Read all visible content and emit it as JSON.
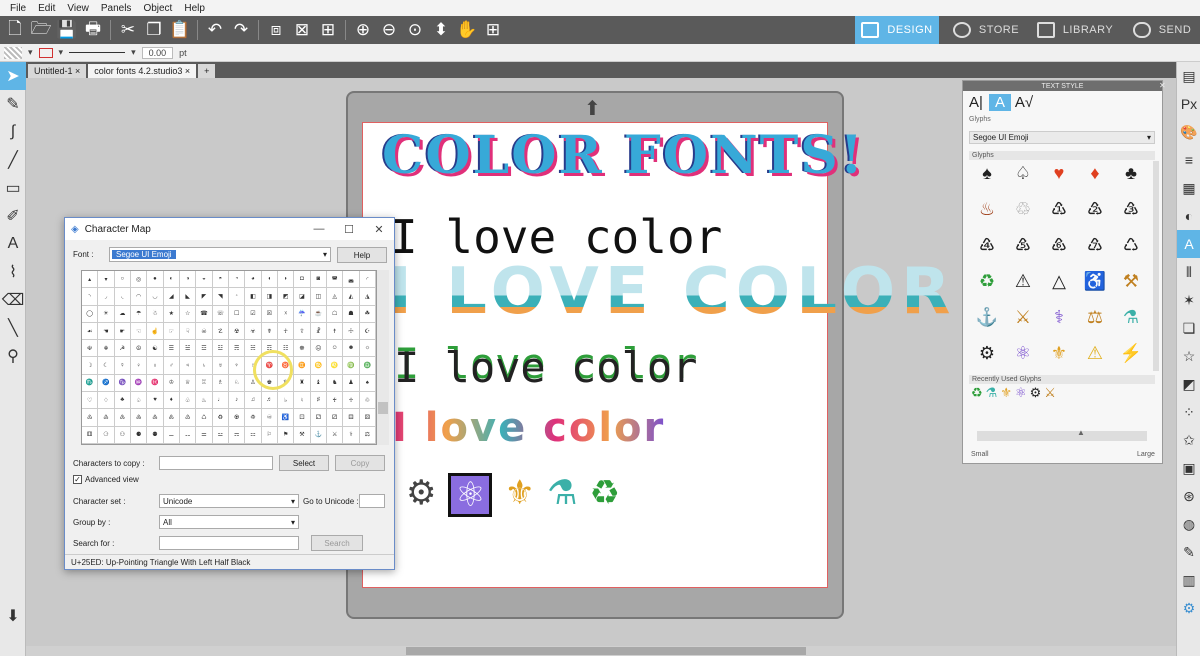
{
  "menu": [
    "File",
    "Edit",
    "View",
    "Panels",
    "Object",
    "Help"
  ],
  "nav_tabs": {
    "design": {
      "label": "DESIGN",
      "color": "#5fb5e6"
    },
    "store": {
      "label": "STORE"
    },
    "library": {
      "label": "LIBRARY"
    },
    "send": {
      "label": "SEND"
    }
  },
  "options": {
    "line_width": "0.00",
    "unit": "pt"
  },
  "doc_tabs": [
    "Untitled-1",
    "color fonts 4.2.studio3",
    "+"
  ],
  "canvas": {
    "line1": "COLOR FONTS!",
    "line2": "I love color",
    "line3": "I LOVE COLOR",
    "line4": "I love color",
    "line5": "I love color",
    "colors": {
      "cyan": "#37a9d8",
      "pink": "#e0307a",
      "orange": "#f0a04b",
      "teal": "#3bb0b8",
      "navy": "#283b8a",
      "green": "#2e9e3a"
    }
  },
  "charmap": {
    "title": "Character Map",
    "font_label": "Font :",
    "font_value": "Segoe UI Emoji",
    "help": "Help",
    "copy_label": "Characters to copy :",
    "select": "Select",
    "copy": "Copy",
    "advanced": "Advanced view",
    "charset_label": "Character set :",
    "charset_value": "Unicode",
    "goto_label": "Go to Unicode :",
    "groupby_label": "Group by :",
    "groupby_value": "All",
    "search_label": "Search for :",
    "search_btn": "Search",
    "status": "U+25ED: Up-Pointing Triangle With Left Half Black"
  },
  "textstyle": {
    "title": "TEXT STYLE",
    "glyphs_label": "Glyphs",
    "font_value": "Segoe UI Emoji",
    "glyphs_section": "Glyphs",
    "recent_label": "Recently Used Glyphs",
    "small": "Small",
    "large": "Large"
  }
}
